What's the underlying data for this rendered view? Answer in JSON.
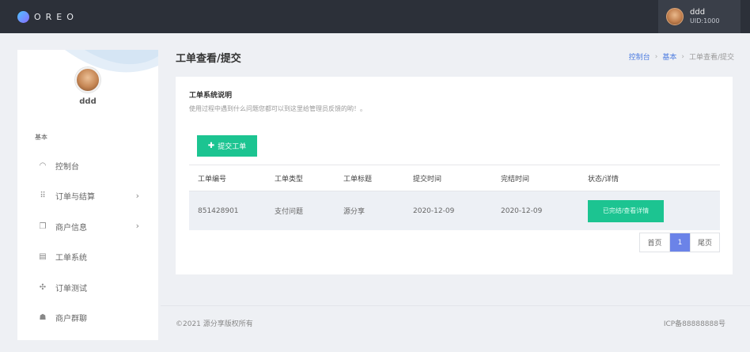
{
  "topbar": {
    "logo_text": "OREO",
    "user": {
      "name": "ddd",
      "uid": "UID:1000"
    }
  },
  "sidebar": {
    "username": "ddd",
    "section_label": "基本",
    "items": [
      {
        "label": "控制台",
        "icon": "dashboard-icon",
        "has_arrow": false
      },
      {
        "label": "订单与结算",
        "icon": "grid-icon",
        "has_arrow": true
      },
      {
        "label": "商户信息",
        "icon": "copy-icon",
        "has_arrow": true
      },
      {
        "label": "工单系统",
        "icon": "ticket-icon",
        "has_arrow": false
      },
      {
        "label": "订单测试",
        "icon": "test-icon",
        "has_arrow": false
      },
      {
        "label": "商户群聊",
        "icon": "group-icon",
        "has_arrow": false
      }
    ]
  },
  "page": {
    "title": "工单查看/提交",
    "breadcrumb": [
      "控制台",
      "基本",
      "工单查看/提交"
    ]
  },
  "card": {
    "title": "工单系统说明",
    "description": "使用过程中遇到什么问题您都可以到这里给管理员反馈的哟！。",
    "submit_label": "提交工单",
    "table": {
      "headers": [
        "工单编号",
        "工单类型",
        "工单标题",
        "提交时间",
        "完结时间",
        "状态/详情"
      ],
      "rows": [
        {
          "id": "851428901",
          "type": "支付问题",
          "title": "源分享",
          "submitted": "2020-12-09",
          "completed": "2020-12-09",
          "status": "已完结/查看详情"
        }
      ]
    },
    "pager": {
      "first": "首页",
      "current": "1",
      "last": "尾页"
    }
  },
  "footer": {
    "copyright": "©2021 源分享版权所有",
    "icp": "ICP备88888888号"
  },
  "colors": {
    "topbar": "#2c3039",
    "accent_green": "#1cc491",
    "pager_active": "#6b83e8",
    "link_blue": "#4d7ce0"
  }
}
